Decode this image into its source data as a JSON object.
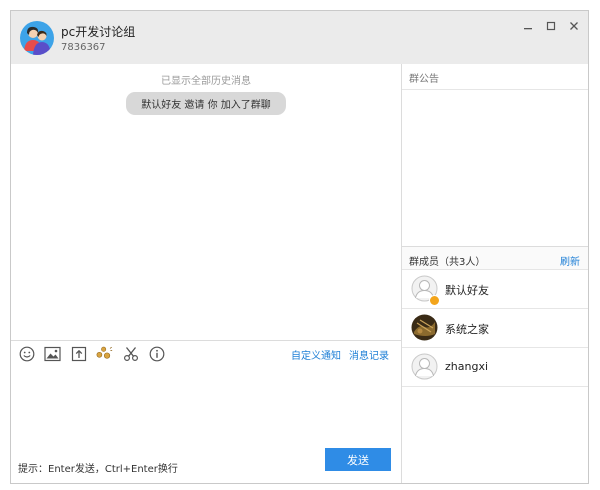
{
  "window": {
    "group_name": "pc开发讨论组",
    "group_id": "7836367"
  },
  "chat": {
    "history_text": "已显示全部历史消息",
    "system_message": "默认好友 邀请 你 加入了群聊"
  },
  "toolbar": {
    "icons": [
      "emoji-icon",
      "image-icon",
      "file-upload-icon",
      "shake-icon",
      "screenshot-scissors-icon",
      "info-icon"
    ],
    "custom_notify_label": "自定义通知",
    "message_history_label": "消息记录"
  },
  "composer": {
    "hint": "提示：Enter发送，Ctrl+Enter换行",
    "send_label": "发送"
  },
  "sidebar": {
    "notice_label": "群公告",
    "members_title": "群成员（共3人）",
    "refresh_label": "刷新",
    "members": [
      {
        "name": "默认好友",
        "avatar": "default-person",
        "badge": true
      },
      {
        "name": "系统之家",
        "avatar": "photo",
        "badge": false
      },
      {
        "name": "zhangxi",
        "avatar": "default-person",
        "badge": false
      }
    ]
  },
  "colors": {
    "accent": "#2f8ce6",
    "link": "#1e7fd6",
    "titlebar": "#ebebeb"
  }
}
